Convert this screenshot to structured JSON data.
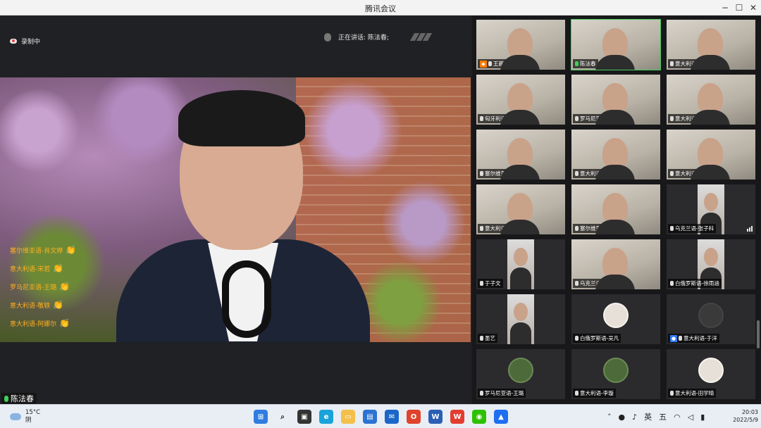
{
  "window": {
    "title": "腾讯会议"
  },
  "status": {
    "recording": "录制中",
    "speaking": "正在讲话: 陈法春;"
  },
  "main_speaker": {
    "name": "陈法春"
  },
  "reactions": [
    {
      "text": "塞尔维亚语-肖文婷"
    },
    {
      "text": "意大利语-宋若"
    },
    {
      "text": "罗马尼亚语-王璐"
    },
    {
      "text": "意大利语-敬轶"
    },
    {
      "text": "意大利语-阿娜尔"
    }
  ],
  "participants": [
    {
      "name": "王巍",
      "host": true,
      "video": true
    },
    {
      "name": "陈法春",
      "active": true,
      "video": true
    },
    {
      "name": "意大利语-阿娜尔",
      "video": true
    },
    {
      "name": "匈牙利语-蓝婉婷",
      "video": true
    },
    {
      "name": "罗马尼亚语-王梓晗",
      "video": true
    },
    {
      "name": "意大利语-徐瀛瑜",
      "video": true
    },
    {
      "name": "塞尔维亚语-肖思洋",
      "video": true
    },
    {
      "name": "意大利语-王丽君",
      "video": true
    },
    {
      "name": "意大利语-宋若智",
      "video": true
    },
    {
      "name": "意大利语-王汪",
      "video": true
    },
    {
      "name": "塞尔维亚语-肖文婷",
      "video": true
    },
    {
      "name": "乌克兰语-张子科",
      "portrait": true
    },
    {
      "name": "于子文",
      "portrait": true
    },
    {
      "name": "乌克兰语-夏蔚鑫",
      "video": true
    },
    {
      "name": "白俄罗斯语-徐雨涵",
      "portrait": true
    },
    {
      "name": "墨艺",
      "portrait": true
    },
    {
      "name": "白俄罗斯语-吴凡",
      "avatar": "light"
    },
    {
      "name": "意大利语-于洋",
      "avatar": "dark",
      "cohost": true
    },
    {
      "name": "罗马尼亚语-王璐",
      "avatar": "green"
    },
    {
      "name": "意大利语-李璇",
      "avatar": "green"
    },
    {
      "name": "意大利语-田学晴",
      "avatar": "light"
    }
  ],
  "taskbar": {
    "weather_temp": "15°C",
    "weather_desc": "阴",
    "ime_lang": "英",
    "ime_mode": "五",
    "time": "20:03",
    "date": "2022/5/9"
  }
}
